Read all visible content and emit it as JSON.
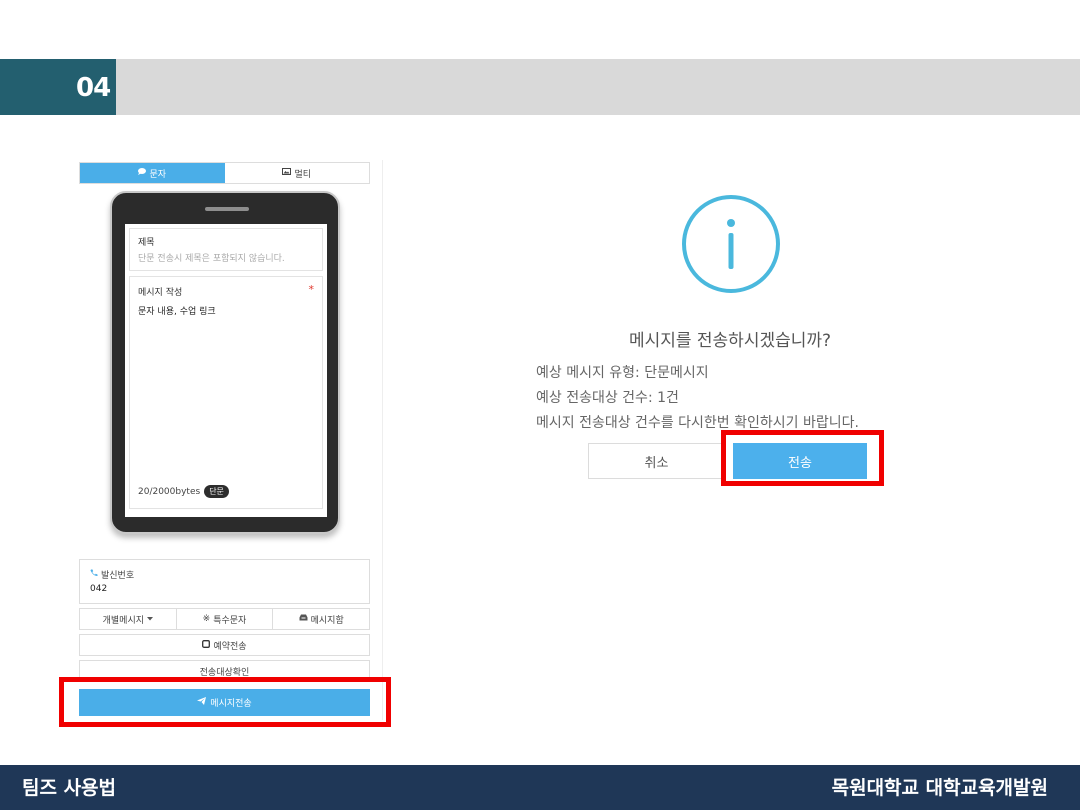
{
  "header": {
    "section_number": "04"
  },
  "left_panel": {
    "tabs": [
      {
        "label": "문자",
        "icon": "speech-bubble-icon",
        "active": true
      },
      {
        "label": "멀티",
        "icon": "image-icon",
        "active": false
      }
    ],
    "phone": {
      "title_label": "제목",
      "title_hint": "단문 전송시 제목은 포함되지 않습니다.",
      "message_label": "메시지 작성",
      "required_mark": "*",
      "message_text": "문자 내용, 수업 링크",
      "byte_count": "20/2000bytes",
      "type_badge": "단문"
    },
    "sender": {
      "label": "발신번호",
      "value": "042"
    },
    "tools": [
      {
        "label": "개별메시지",
        "icon": "caret-down-icon"
      },
      {
        "label": "특수문자",
        "icon": "reference-mark-icon"
      },
      {
        "label": "메시지함",
        "icon": "inbox-icon"
      }
    ],
    "reserve_label": "예약전송",
    "confirm_label": "전송대상확인",
    "send_label": "메시지전송"
  },
  "dialog": {
    "title": "메시지를 전송하시겠습니까?",
    "lines": [
      "예상 메시지 유형: 단문메시지",
      "예상 전송대상 건수: 1건",
      "메시지 전송대상 건수를 다시한번 확인하시기 바랍니다."
    ],
    "cancel_label": "취소",
    "send_label": "전송"
  },
  "footer": {
    "left_text": "팀즈 사용법",
    "right_text": "목원대학교 대학교육개발원"
  },
  "colors": {
    "accent_blue": "#4aaee8",
    "highlight_red": "#f00000",
    "footer_navy": "#1f3757",
    "header_teal": "#235f6f",
    "info_icon": "#4ab8dd"
  }
}
